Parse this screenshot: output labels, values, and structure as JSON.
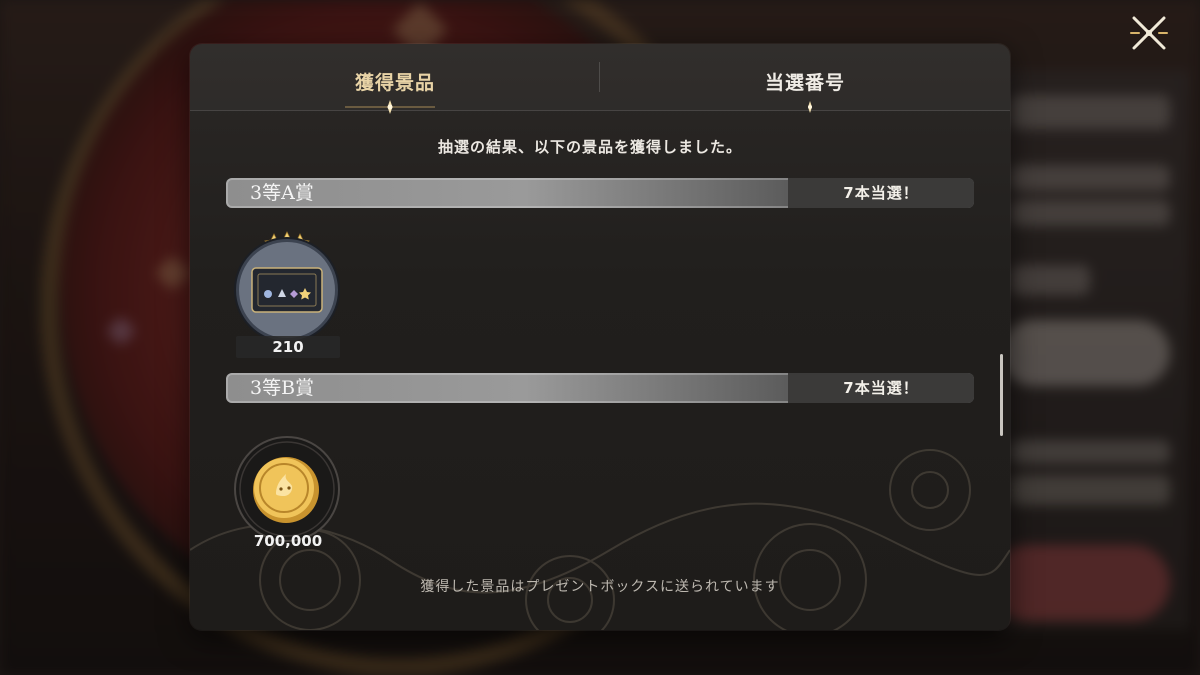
{
  "tabs": [
    {
      "label": "獲得景品",
      "active": true
    },
    {
      "label": "当選番号",
      "active": false
    }
  ],
  "intro_text": "抽選の結果、以下の景品を獲得しました。",
  "prizes": [
    {
      "tier": "3等A賞",
      "count_label": "7本当選！",
      "item": {
        "icon": "ticket-icon",
        "rarity_stars": 3,
        "quantity": "210"
      }
    },
    {
      "tier": "3等B賞",
      "count_label": "7本当選！",
      "item": {
        "icon": "gold-coin-icon",
        "quantity": "700,000"
      }
    }
  ],
  "footer_text": "獲得した景品はプレゼントボックスに送られています",
  "colors": {
    "active_tab": "#e8d3a6",
    "accent_gold": "#d8b46a",
    "modal_bg": "#221f1d"
  }
}
